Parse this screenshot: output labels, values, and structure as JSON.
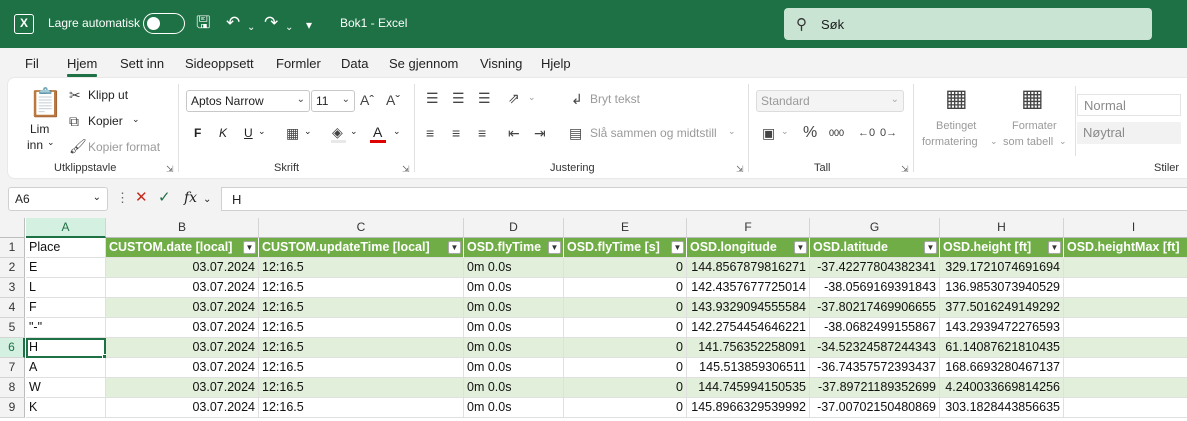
{
  "titlebar": {
    "autosave_label": "Lagre automatisk",
    "doc_title": "Bok1  -  Excel",
    "search_placeholder": "Søk"
  },
  "tabs": [
    "Fil",
    "Hjem",
    "Sett inn",
    "Sideoppsett",
    "Formler",
    "Data",
    "Se gjennom",
    "Visning",
    "Hjelp"
  ],
  "active_tab": "Hjem",
  "ribbon": {
    "clipboard": {
      "paste_label": "Lim",
      "paste_label2": "inn",
      "cut": "Klipp ut",
      "copy": "Kopier",
      "format_painter": "Kopier format",
      "group": "Utklippstavle"
    },
    "font": {
      "font_name": "Aptos Narrow",
      "font_size": "11",
      "bold": "F",
      "italic": "K",
      "underline": "U",
      "group": "Skrift"
    },
    "alignment": {
      "wrap_text": "Bryt tekst",
      "merge_center": "Slå sammen og midtstill",
      "group": "Justering"
    },
    "number": {
      "format": "Standard",
      "group": "Tall"
    },
    "styles": {
      "conditional_1": "Betinget",
      "conditional_2": "formatering",
      "as_table_1": "Formater",
      "as_table_2": "som tabell",
      "normal": "Normal",
      "neutral": "Nøytral",
      "group": "Stiler"
    }
  },
  "formula_bar": {
    "name_box": "A6",
    "fx": "fx",
    "value": "H"
  },
  "columns": [
    "A",
    "B",
    "C",
    "D",
    "E",
    "F",
    "G",
    "H",
    "I"
  ],
  "selected_column": "A",
  "rows": [
    "1",
    "2",
    "3",
    "4",
    "5",
    "6",
    "7",
    "8",
    "9"
  ],
  "selected_row": "6",
  "table": {
    "place_header": "Place",
    "headers": [
      "CUSTOM.date [local]",
      "CUSTOM.updateTime [local]",
      "OSD.flyTime",
      "OSD.flyTime [s]",
      "OSD.longitude",
      "OSD.latitude",
      "OSD.height [ft]",
      "OSD.heightMax [ft]"
    ],
    "rows": [
      [
        "E",
        "03.07.2024",
        "12:16.5",
        "0m 0.0s",
        "0",
        "144.8567879816271",
        "-37.42277804382341",
        "329.1721074691694",
        ""
      ],
      [
        "L",
        "03.07.2024",
        "12:16.5",
        "0m 0.0s",
        "0",
        "142.4357677725014",
        "-38.0569169391843",
        "136.9853073940529",
        ""
      ],
      [
        "F",
        "03.07.2024",
        "12:16.5",
        "0m 0.0s",
        "0",
        "143.9329094555584",
        "-37.80217469906655",
        "377.5016249149292",
        ""
      ],
      [
        "\"-\"",
        "03.07.2024",
        "12:16.5",
        "0m 0.0s",
        "0",
        "142.2754454646221",
        "-38.0682499155867",
        "143.2939472276593",
        ""
      ],
      [
        "H",
        "03.07.2024",
        "12:16.5",
        "0m 0.0s",
        "0",
        "141.756352258091",
        "-34.52324587244343",
        "61.14087621810435",
        ""
      ],
      [
        "A",
        "03.07.2024",
        "12:16.5",
        "0m 0.0s",
        "0",
        "145.513859306511",
        "-36.74357572393437",
        "168.6693280467137",
        ""
      ],
      [
        "W",
        "03.07.2024",
        "12:16.5",
        "0m 0.0s",
        "0",
        "144.745994150535",
        "-37.89721189352699",
        "4.240033669814256",
        ""
      ],
      [
        "K",
        "03.07.2024",
        "12:16.5",
        "0m 0.0s",
        "0",
        "145.8966329539992",
        "-37.00702150480869",
        "303.1828443856635",
        ""
      ]
    ]
  },
  "colors": {
    "excel_green": "#1e7145",
    "table_header": "#70ad47",
    "table_band": "#e2efda"
  }
}
